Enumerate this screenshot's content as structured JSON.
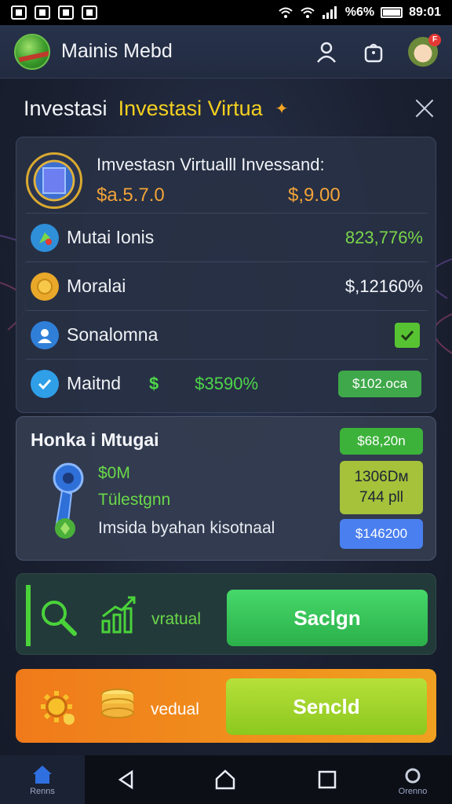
{
  "status_bar": {
    "right_text": "%6%",
    "time": "89:01"
  },
  "header": {
    "app_title": "Mainis Mebd",
    "notification_badge": "F"
  },
  "dialog": {
    "title_part1": "Investasi",
    "title_part2": "Investasi Virtua"
  },
  "summary": {
    "label": "Imvestasn Virtualll Invessand:",
    "value_1": "$a.5.7.0",
    "value_2": "$,9.00"
  },
  "rows": [
    {
      "label": "Mutai Ionis",
      "value": "823,776%"
    },
    {
      "label": "Moralai",
      "value": "$,12160%"
    },
    {
      "label": "Sonalomna"
    },
    {
      "label": "Maitnd",
      "currency_symbol": "$",
      "value": "$3590%",
      "tag": "$102.oca"
    }
  ],
  "card2": {
    "title": "Honka i Mtugai",
    "line1": "$0M",
    "line2": "Tülestgnn",
    "line3": "Imsida byahan kisotnaal",
    "badge1": "$68,20n",
    "badge2_line1": "1306Dм",
    "badge2_line2": "744 pll",
    "badge3": "$146200"
  },
  "action1": {
    "label": "vratual",
    "button": "Saclgn"
  },
  "action2": {
    "label": "vedual",
    "button": "Sencld"
  },
  "bottom_nav": {
    "home_label": "Renns",
    "right_label": "Orenno"
  },
  "colors": {
    "accent_yellow": "#f4d020",
    "accent_green": "#4ed64a",
    "accent_orange": "#f2a33a"
  }
}
